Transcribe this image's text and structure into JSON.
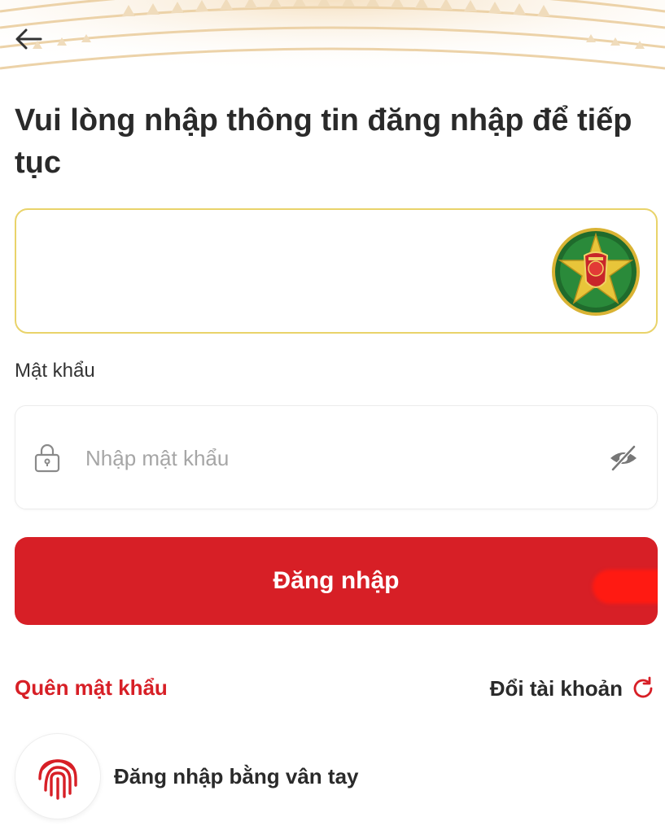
{
  "header": {
    "back_icon": "arrow-left-icon",
    "pattern_color": "#e9c99a"
  },
  "title": "Vui lòng nhập thông tin đăng nhập để tiếp tục",
  "username_field": {
    "value": "",
    "emblem_icon": "police-emblem-icon",
    "border_color": "#e9d36a"
  },
  "password": {
    "label": "Mật khẩu",
    "placeholder": "Nhập mật khẩu",
    "value": "",
    "lock_icon": "lock-icon",
    "toggle_icon": "eye-off-icon"
  },
  "login_button": {
    "label": "Đăng nhập",
    "color": "#d71f26"
  },
  "links": {
    "forgot_password": "Quên mật khẩu",
    "switch_account": "Đổi tài khoản",
    "switch_icon": "refresh-icon"
  },
  "fingerprint": {
    "label": "Đăng nhập bằng vân tay",
    "icon": "fingerprint-icon"
  },
  "colors": {
    "accent": "#d71f26",
    "text": "#2a2a2a",
    "placeholder": "#a6a6a6"
  }
}
